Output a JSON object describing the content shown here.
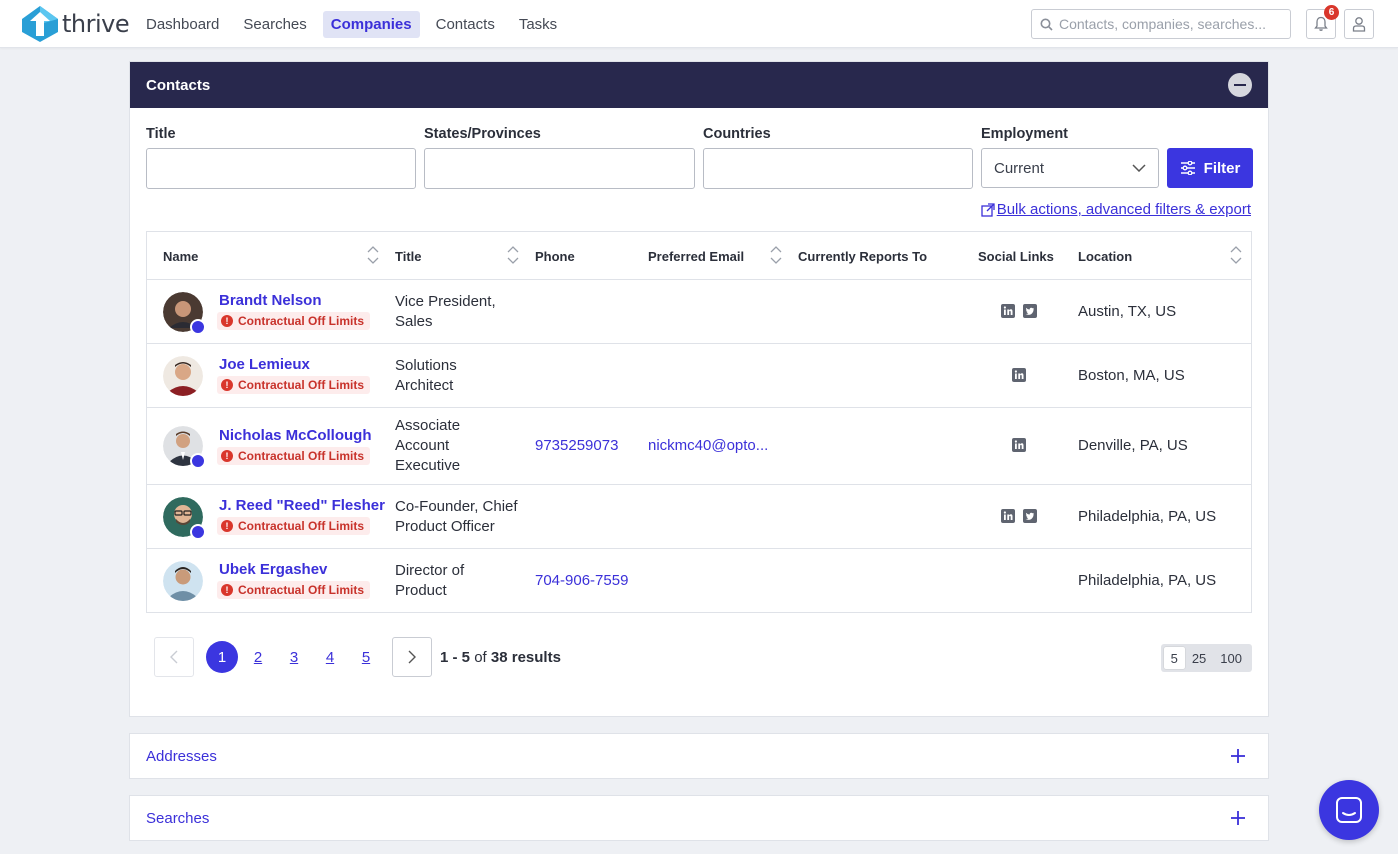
{
  "app": {
    "name": "thrive",
    "brand_color": "#3b36e0"
  },
  "nav": {
    "items": [
      {
        "label": "Dashboard",
        "active": false
      },
      {
        "label": "Searches",
        "active": false
      },
      {
        "label": "Companies",
        "active": true
      },
      {
        "label": "Contacts",
        "active": false
      },
      {
        "label": "Tasks",
        "active": false
      }
    ],
    "search_placeholder": "Contacts, companies, searches...",
    "notification_count": "6"
  },
  "contacts_panel": {
    "title": "Contacts",
    "filters": {
      "title_label": "Title",
      "title_value": "",
      "states_label": "States/Provinces",
      "states_value": "",
      "countries_label": "Countries",
      "countries_value": "",
      "employment_label": "Employment",
      "employment_value": "Current",
      "filter_button": "Filter"
    },
    "bulk_link": "Bulk actions, advanced filters & export",
    "columns": [
      "Name",
      "Title",
      "Phone",
      "Preferred Email",
      "Currently Reports To",
      "Social Links",
      "Location"
    ],
    "rows": [
      {
        "name": "Brandt Nelson",
        "tag": "Contractual Off Limits",
        "title_lines": [
          "Vice President,",
          "Sales"
        ],
        "phone": "",
        "email": "",
        "reports_to": "",
        "linkedin": true,
        "twitter": true,
        "location": "Austin, TX, US",
        "verified": true
      },
      {
        "name": "Joe Lemieux",
        "tag": "Contractual Off Limits",
        "title_lines": [
          "Solutions",
          "Architect"
        ],
        "phone": "",
        "email": "",
        "reports_to": "",
        "linkedin": true,
        "twitter": false,
        "location": "Boston, MA, US",
        "verified": false
      },
      {
        "name": "Nicholas McCollough",
        "tag": "Contractual Off Limits",
        "title_lines": [
          "Associate",
          "Account",
          "Executive"
        ],
        "phone": "9735259073",
        "email": "nickmc40@opto...",
        "reports_to": "",
        "linkedin": true,
        "twitter": false,
        "location": "Denville, PA, US",
        "verified": true
      },
      {
        "name": "J. Reed \"Reed\" Flesher",
        "tag": "Contractual Off Limits",
        "title_lines": [
          "Co-Founder, Chief",
          "Product Officer"
        ],
        "phone": "",
        "email": "",
        "reports_to": "",
        "linkedin": true,
        "twitter": true,
        "location": "Philadelphia, PA, US",
        "verified": true
      },
      {
        "name": "Ubek Ergashev",
        "tag": "Contractual Off Limits",
        "title_lines": [
          "Director of",
          "Product"
        ],
        "phone": "704-906-7559",
        "email": "",
        "reports_to": "",
        "linkedin": false,
        "twitter": false,
        "location": "Philadelphia, PA, US",
        "verified": false
      }
    ],
    "pagination": {
      "pages": [
        "1",
        "2",
        "3",
        "4",
        "5"
      ],
      "current_page": "1",
      "range": "1 - 5",
      "of": "of",
      "total": "38 results",
      "page_sizes": [
        "5",
        "25",
        "100"
      ],
      "selected_page_size": "5"
    }
  },
  "addresses_panel": {
    "title": "Addresses"
  },
  "searches_panel": {
    "title": "Searches"
  }
}
